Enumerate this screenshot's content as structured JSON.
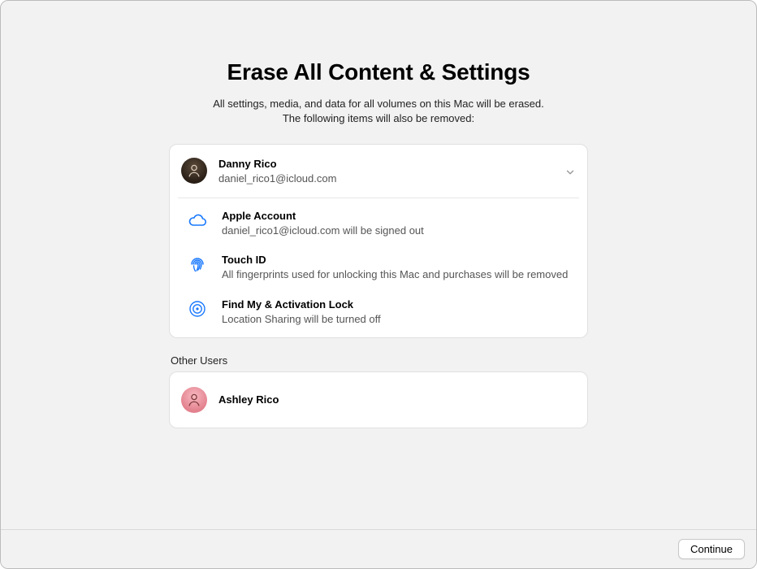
{
  "title": "Erase All Content & Settings",
  "subtitle": "All settings, media, and data for all volumes on this Mac will be erased.\nThe following items will also be removed:",
  "primaryUser": {
    "name": "Danny Rico",
    "subtitle": "daniel_rico1@icloud.com"
  },
  "items": [
    {
      "icon": "cloud-icon",
      "title": "Apple Account",
      "detail": "daniel_rico1@icloud.com will be signed out"
    },
    {
      "icon": "fingerprint-icon",
      "title": "Touch ID",
      "detail": "All fingerprints used for unlocking this Mac and purchases will be removed"
    },
    {
      "icon": "findmy-icon",
      "title": "Find My & Activation Lock",
      "detail": "Location Sharing will be turned off"
    }
  ],
  "otherUsersLabel": "Other Users",
  "otherUsers": [
    {
      "name": "Ashley Rico"
    }
  ],
  "footer": {
    "continue": "Continue"
  }
}
